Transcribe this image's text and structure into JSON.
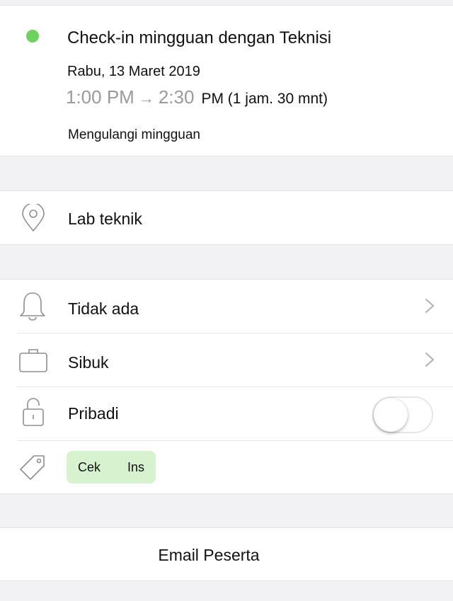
{
  "colors": {
    "calendar_dot": "#6dd35e",
    "tag_background": "#d6f2cf"
  },
  "event": {
    "title": "Check-in mingguan dengan Teknisi",
    "date": "Rabu, 13 Maret 2019",
    "start_time": "1:00 PM",
    "arrow": "→",
    "end_time": "2:30",
    "duration": "PM (1 jam. 30 mnt)",
    "recurrence": "Mengulangi mingguan"
  },
  "location": {
    "icon": "location-pin-icon",
    "label": "Lab teknik"
  },
  "settings": {
    "reminder": {
      "icon": "bell-icon",
      "label": "Tidak ada"
    },
    "status": {
      "icon": "briefcase-icon",
      "label": "Sibuk"
    },
    "private": {
      "icon": "lock-icon",
      "label": "Pribadi",
      "enabled": false
    },
    "tags": {
      "icon": "tag-icon",
      "items": [
        "Cek",
        "Ins"
      ]
    }
  },
  "email": {
    "label": "Email Peserta"
  }
}
